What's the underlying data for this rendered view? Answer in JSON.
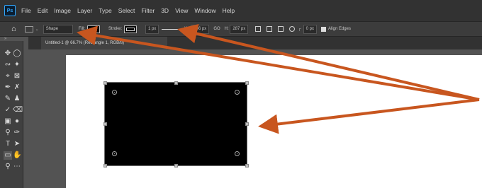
{
  "app": {
    "logo_text": "Ps"
  },
  "menu": [
    "File",
    "Edit",
    "Image",
    "Layer",
    "Type",
    "Select",
    "Filter",
    "3D",
    "View",
    "Window",
    "Help"
  ],
  "options": {
    "mode": "Shape",
    "fill_label": "Fill:",
    "stroke_label": "Stroke:",
    "stroke_width": "1 px",
    "w_label": "W:",
    "w_value": "496 px",
    "link_label": "GO",
    "h_label": "H:",
    "h_value": "287 px",
    "corner_radius": "0 px",
    "align_edges": "Align Edges"
  },
  "document": {
    "tab_title": "Untitled-1 @ 66.7% (Rectangle 1, RGB/8)"
  },
  "annotation": {
    "arrow_color": "#c8561f"
  }
}
